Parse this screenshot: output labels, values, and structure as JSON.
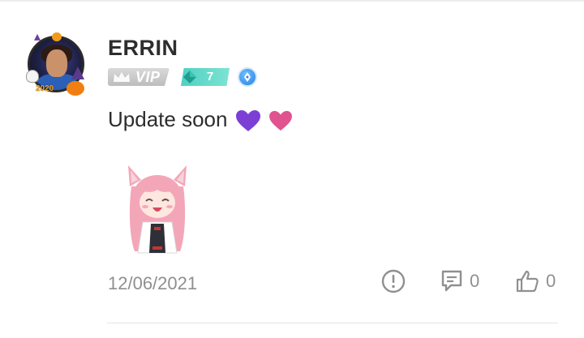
{
  "post": {
    "author": {
      "name": "ERRIN",
      "avatar_frame_year": "2020",
      "vip_label": "VIP",
      "level": "7"
    },
    "message": "Update soon",
    "emoji": [
      "purple-heart",
      "pink-heart"
    ],
    "date": "12/06/2021",
    "comment_count": "0",
    "like_count": "0"
  },
  "colors": {
    "text": "#2d2d2d",
    "muted": "#8f8f8f",
    "level_badge": "#4fd0c3",
    "purple_heart": "#7b3fd6",
    "pink_heart": "#e0538f"
  },
  "icons": [
    "report-icon",
    "comment-icon",
    "like-icon",
    "vip-crown-icon",
    "level-gem-icon",
    "writer-pen-icon"
  ]
}
